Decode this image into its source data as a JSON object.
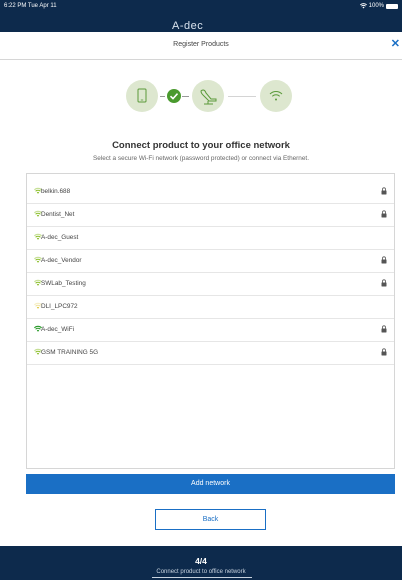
{
  "status_bar": {
    "time": "6:22 PM  Tue Apr 11",
    "battery": "100%"
  },
  "brand": {
    "logo_text": "A-dec"
  },
  "nav": {
    "title": "Register Products",
    "close_symbol": "✕"
  },
  "heading": {
    "title": "Connect product to your office network",
    "subtitle": "Select a secure Wi-Fi network (password protected) or connect via Ethernet."
  },
  "networks": [
    {
      "name": "belkin.688",
      "secured": true,
      "wifi_color": "#8cbf2b"
    },
    {
      "name": "Dentist_Net",
      "secured": true,
      "wifi_color": "#8cbf2b"
    },
    {
      "name": "A-dec_Guest",
      "secured": false,
      "wifi_color": "#8cbf2b"
    },
    {
      "name": "A-dec_Vendor",
      "secured": true,
      "wifi_color": "#8cbf2b"
    },
    {
      "name": "SWLab_Testing",
      "secured": true,
      "wifi_color": "#8cbf2b"
    },
    {
      "name": "DLI_LPC972",
      "secured": false,
      "wifi_color": "#e0c840"
    },
    {
      "name": "A-dec_WiFi",
      "secured": true,
      "wifi_color": "#2a9a2a"
    },
    {
      "name": "GSM TRAINING 5G",
      "secured": true,
      "wifi_color": "#8cbf2b"
    }
  ],
  "actions": {
    "add_network_label": "Add network",
    "back_label": "Back"
  },
  "footer": {
    "step_count": "4/4",
    "step_label": "Connect product to office network"
  },
  "colors": {
    "accent": "#1a6fc5",
    "dark_navy": "#0d2a4c",
    "step_bg": "#dde7cf",
    "check_green": "#4a9a2e"
  }
}
